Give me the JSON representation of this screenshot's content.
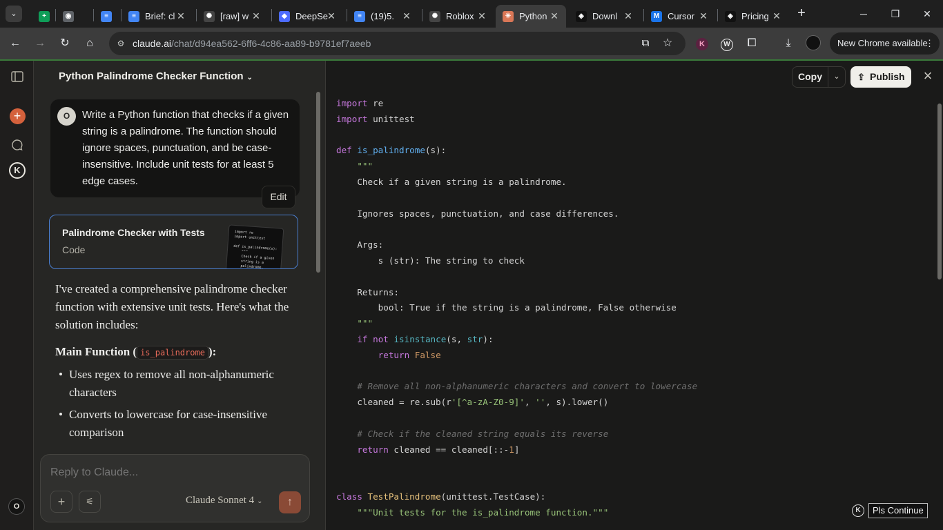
{
  "browser": {
    "tabs": [
      {
        "title": "",
        "favicon": "sheets-icon",
        "color": "#0f9d58",
        "glyph": "+"
      },
      {
        "title": "",
        "favicon": "globe-icon",
        "color": "#5f6368",
        "glyph": "◉"
      },
      {
        "title": "",
        "favicon": "docs-icon",
        "color": "#4285f4",
        "glyph": "≡"
      },
      {
        "title": "Brief: cl",
        "favicon": "docs-icon",
        "color": "#4285f4",
        "glyph": "≡"
      },
      {
        "title": "[raw] w",
        "favicon": "openai-icon",
        "color": "#444",
        "glyph": "✺"
      },
      {
        "title": "DeepSe",
        "favicon": "deepseek-icon",
        "color": "#4d6bfe",
        "glyph": "◆"
      },
      {
        "title": "(19)5.",
        "favicon": "docs-icon",
        "color": "#4285f4",
        "glyph": "≡"
      },
      {
        "title": "Roblox",
        "favicon": "openai-icon",
        "color": "#444",
        "glyph": "✺"
      },
      {
        "title": "Python",
        "favicon": "claude-icon",
        "color": "#d97757",
        "glyph": "✳",
        "active": true
      },
      {
        "title": "Downl",
        "favicon": "cursor-icon",
        "color": "#111",
        "glyph": "◈"
      },
      {
        "title": "Cursor",
        "favicon": "m-icon",
        "color": "#1a73e8",
        "glyph": "M"
      },
      {
        "title": "Pricing",
        "favicon": "cursor-icon",
        "color": "#111",
        "glyph": "◈"
      }
    ],
    "url_domain": "claude.ai",
    "url_path": "/chat/d94ea562-6ff6-4c86-aa89-b9781ef7aeeb",
    "update_label": "New Chrome available"
  },
  "chat": {
    "title": "Python Palindrome Checker Function",
    "user_initial": "O",
    "user_message": "Write a Python function that checks if a given string is a palindrome. The function should ignore spaces, punctuation, and be case-insensitive. Include unit tests for at least 5 edge cases.",
    "edit_label": "Edit",
    "artifact": {
      "title": "Palindrome Checker with Tests",
      "kind": "Code",
      "thumb_text": "import re\nimport unittest\n\ndef is_palindrome(s):\n    \"\"\"\n    Check if a given\n    string is a\n    palindrome.\n\n    Ignores spa"
    },
    "reply_intro": "I've created a comprehensive palindrome checker function with extensive unit tests. Here's what the solution includes:",
    "reply_heading_pre": "Main Function (",
    "reply_heading_code": "is_palindrome",
    "reply_heading_post": "):",
    "bullets": [
      "Uses regex to remove all non-alphanumeric characters",
      "Converts to lowercase for case-insensitive comparison"
    ],
    "composer_placeholder": "Reply to Claude...",
    "model_label": "Claude Sonnet 4",
    "bottom_avatar_initial": "O"
  },
  "artifact_pane": {
    "copy_label": "Copy",
    "publish_label": "Publish"
  },
  "extension": {
    "k_label": "K",
    "continue_label": "Pls Continue"
  }
}
